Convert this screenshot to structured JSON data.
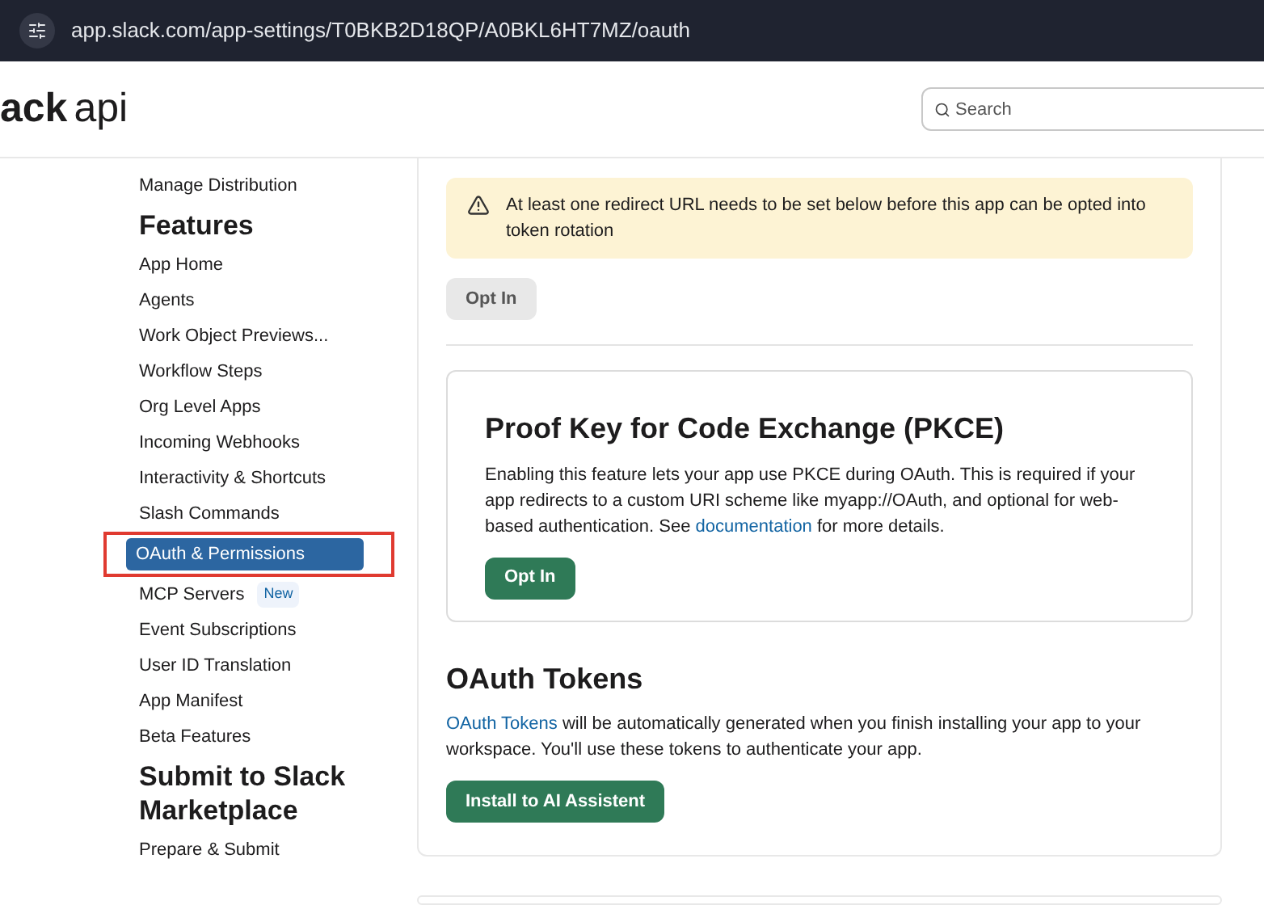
{
  "browser": {
    "url": "app.slack.com/app-settings/T0BKB2D18QP/A0BKL6HT7MZ/oauth"
  },
  "header": {
    "logo": {
      "bold": "ack",
      "light": "api"
    },
    "search": {
      "placeholder": "Search"
    }
  },
  "sidebar": {
    "items": [
      {
        "kind": "link",
        "label": "Manage Distribution",
        "selected": false
      },
      {
        "kind": "heading",
        "label": "Features"
      },
      {
        "kind": "link",
        "label": "App Home",
        "selected": false
      },
      {
        "kind": "link",
        "label": "Agents",
        "selected": false
      },
      {
        "kind": "link",
        "label": "Work Object Previews...",
        "selected": false
      },
      {
        "kind": "link",
        "label": "Workflow Steps",
        "selected": false
      },
      {
        "kind": "link",
        "label": "Org Level Apps",
        "selected": false
      },
      {
        "kind": "link",
        "label": "Incoming Webhooks",
        "selected": false
      },
      {
        "kind": "link",
        "label": "Interactivity & Shortcuts",
        "selected": false
      },
      {
        "kind": "link",
        "label": "Slash Commands",
        "selected": false
      },
      {
        "kind": "link",
        "label": "OAuth & Permissions",
        "selected": true
      },
      {
        "kind": "link",
        "label": "MCP Servers",
        "selected": false,
        "badge": "New"
      },
      {
        "kind": "link",
        "label": "Event Subscriptions",
        "selected": false
      },
      {
        "kind": "link",
        "label": "User ID Translation",
        "selected": false
      },
      {
        "kind": "link",
        "label": "App Manifest",
        "selected": false
      },
      {
        "kind": "link",
        "label": "Beta Features",
        "selected": false
      },
      {
        "kind": "heading",
        "label": "Submit to Slack Marketplace"
      },
      {
        "kind": "link",
        "label": "Prepare & Submit",
        "selected": false
      }
    ]
  },
  "main": {
    "warning": {
      "text": "At least one redirect URL needs to be set below before this app can be opted into token rotation"
    },
    "rotation_button": {
      "label": "Opt In",
      "disabled": true
    },
    "pkce": {
      "title": "Proof Key for Code Exchange (PKCE)",
      "text": [
        {
          "kind": "text",
          "text": "Enabling this feature lets your app use PKCE during OAuth. This is required if your app redirects to a custom URI scheme like myapp://OAuth, and optional for web-based authentication. See "
        },
        {
          "kind": "link",
          "text": "documentation"
        },
        {
          "kind": "text",
          "text": " for more details."
        }
      ],
      "button": {
        "label": "Opt In",
        "disabled": false
      }
    },
    "tokens": {
      "title": "OAuth Tokens",
      "text": [
        {
          "kind": "link",
          "text": "OAuth Tokens"
        },
        {
          "kind": "text",
          "text": " will be automatically generated when you finish installing your app to your workspace. You'll use these tokens to authenticate your app."
        }
      ],
      "button": {
        "label": "Install to AI Assistent",
        "disabled": false
      }
    }
  }
}
